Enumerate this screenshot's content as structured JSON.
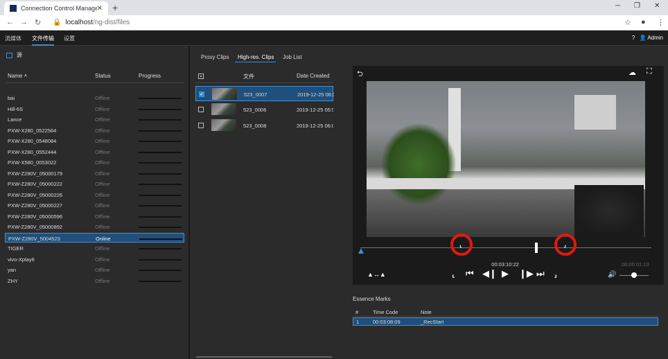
{
  "browser": {
    "tab_title": "Connection Control Manager",
    "tab_close": "✕",
    "new_tab": "+",
    "url_host": "localhost",
    "url_path": "/ng-dist/files"
  },
  "app": {
    "nav": [
      "流媒体",
      "文件传输",
      "设置"
    ],
    "admin": "Admin"
  },
  "left": {
    "source_label": "源",
    "columns": {
      "name": "Name ˄",
      "status": "Status",
      "progress": "Progress"
    },
    "devices": [
      {
        "name": "bai",
        "status": "Offline"
      },
      {
        "name": "Hill-6S",
        "status": "Offline"
      },
      {
        "name": "Lance",
        "status": "Offline"
      },
      {
        "name": "PXW-X280_0522564",
        "status": "Offline"
      },
      {
        "name": "PXW-X280_0548084",
        "status": "Offline"
      },
      {
        "name": "PXW-X280_0552444",
        "status": "Offline"
      },
      {
        "name": "PXW-X580_0053022",
        "status": "Offline"
      },
      {
        "name": "PXW-Z280V_05000179",
        "status": "Offline"
      },
      {
        "name": "PXW-Z280V_05000222",
        "status": "Offline"
      },
      {
        "name": "PXW-Z280V_05000226",
        "status": "Offline"
      },
      {
        "name": "PXW-Z280V_05000227",
        "status": "Offline"
      },
      {
        "name": "PXW-Z280V_05000596",
        "status": "Offline"
      },
      {
        "name": "PXW-Z280V_05000892",
        "status": "Offline"
      },
      {
        "name": "PXW-Z280V_5004523",
        "status": "Online"
      },
      {
        "name": "TIGER",
        "status": "Offline"
      },
      {
        "name": "vivo-Xplay6",
        "status": "Offline"
      },
      {
        "name": "yan",
        "status": "Offline"
      },
      {
        "name": "ZHY",
        "status": "Offline"
      }
    ],
    "selected_index": 13
  },
  "middle": {
    "tabs": [
      "Proxy Clips",
      "High-res. Clips",
      "Job List"
    ],
    "active_tab": 1,
    "columns": {
      "file": "文件",
      "date": "Date Created"
    },
    "clips": [
      {
        "name": "523_0007",
        "date": "2019-12-25 06:0",
        "checked": true
      },
      {
        "name": "523_0006",
        "date": "2019-12-25 05:5",
        "checked": false
      },
      {
        "name": "523_0008",
        "date": "2019-12-25 06:0",
        "checked": false
      }
    ]
  },
  "player": {
    "current_tc": "00:03:10:22",
    "duration_tc": "00:00:01:13"
  },
  "essence": {
    "title": "Essence Marks",
    "columns": {
      "num": "#",
      "tc": "Time Code",
      "note": "Note"
    },
    "rows": [
      {
        "num": "1",
        "tc": "00:03:08:09",
        "note": "_RecStart"
      }
    ]
  }
}
